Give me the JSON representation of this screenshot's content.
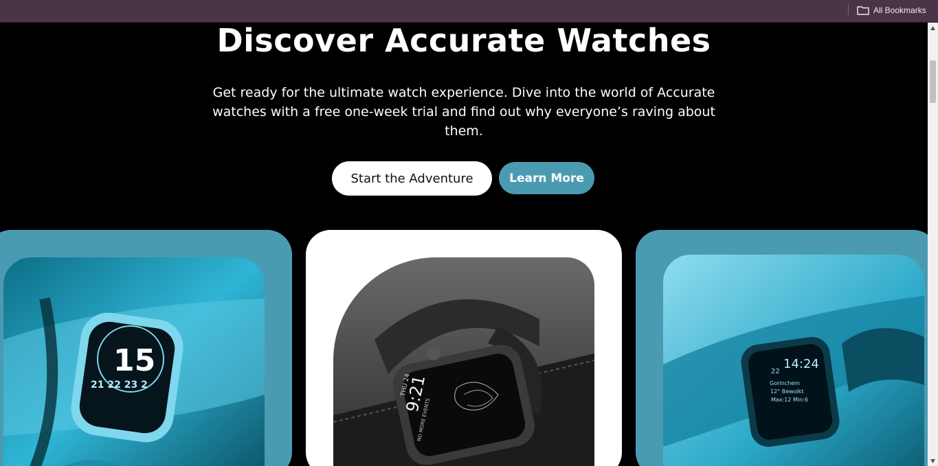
{
  "browser": {
    "bookmarks": {
      "all_bookmarks_label": "All Bookmarks"
    }
  },
  "hero": {
    "title": "Discover Accurate Watches",
    "subtitle_lines": [
      "Get ready for the ultimate watch experience. Dive into the world of Accurate",
      "watches with a free one-week trial and find out why everyone’s raving about",
      "them."
    ],
    "primary_button": "Start the Adventure",
    "secondary_button": "Learn More"
  },
  "cards": [
    {
      "style": "teal",
      "image_alt": "watch on wrist with 15 on display",
      "watch_face": {
        "big": "15",
        "row": "21 22 23 2"
      }
    },
    {
      "style": "white",
      "image_alt": "black watch with link band",
      "watch_face": {
        "date": "THU 24",
        "time": "9:21",
        "caption": "NO MORE EVENTS"
      }
    },
    {
      "style": "teal",
      "image_alt": "watch on wet wrist",
      "watch_face": {
        "day": "22",
        "time": "14:24",
        "lines": [
          "Gorinchem",
          "12° Bewolkt",
          "Max:12 Min:6"
        ]
      }
    }
  ],
  "colors": {
    "accent": "#4a9bb2",
    "bookmark_bar": "#4a3446",
    "background": "#000000"
  }
}
